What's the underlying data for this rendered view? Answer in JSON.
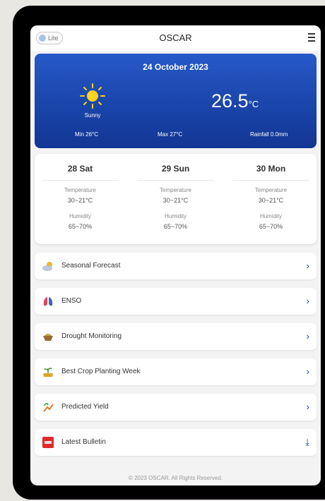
{
  "header": {
    "lite_label": "Lite",
    "title": "OSCAR"
  },
  "weather": {
    "date": "24 October 2023",
    "condition": "Sunny",
    "temperature": "26.5",
    "temperature_unit": "°C",
    "min": "Min 26°C",
    "max": "Max 27°C",
    "rainfall": "Rainfall 0.0mm"
  },
  "forecast": [
    {
      "day": "28 Sat",
      "temp_label": "Temperature",
      "temp": "30~21°C",
      "humidity_label": "Humidity",
      "humidity": "65~70%"
    },
    {
      "day": "29 Sun",
      "temp_label": "Temperature",
      "temp": "30~21°C",
      "humidity_label": "Humidity",
      "humidity": "65~70%"
    },
    {
      "day": "30 Mon",
      "temp_label": "Temperature",
      "temp": "30~21°C",
      "humidity_label": "Humidity",
      "humidity": "65~70%"
    }
  ],
  "menu": [
    {
      "label": "Seasonal Forecast",
      "icon": "cloud-sun-icon",
      "action": "›"
    },
    {
      "label": "ENSO",
      "icon": "lungs-icon",
      "action": "›"
    },
    {
      "label": "Drought Monitoring",
      "icon": "drought-icon",
      "action": "›"
    },
    {
      "label": "Best Crop Planting Week",
      "icon": "crop-planting-icon",
      "action": "›"
    },
    {
      "label": "Predicted Yield",
      "icon": "yield-icon",
      "action": "›"
    },
    {
      "label": "Latest Bulletin",
      "icon": "pdf-icon",
      "action": "⤓"
    }
  ],
  "footer": "© 2023 OSCAR. All Rights Reserved.",
  "colors": {
    "accent": "#1a45aa",
    "chevron": "#1a3b9b"
  }
}
